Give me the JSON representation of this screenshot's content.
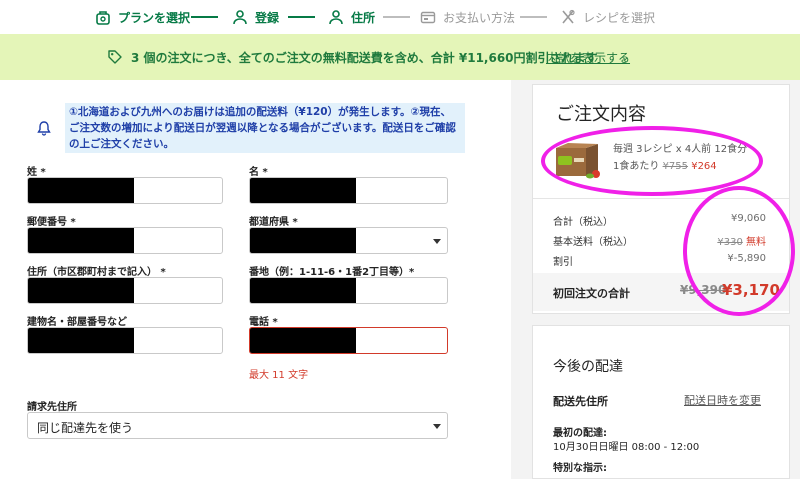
{
  "steps": [
    {
      "label": "プランを選択",
      "icon": "bag-icon"
    },
    {
      "label": "登録",
      "icon": "user-icon"
    },
    {
      "label": "住所",
      "icon": "user-icon"
    },
    {
      "label": "お支払い方法",
      "icon": "card-icon"
    },
    {
      "label": "レシピを選択",
      "icon": "utensils-icon"
    }
  ],
  "colors": {
    "accent": "#067a46",
    "banner_bg": "#e4f5b8",
    "error": "#d23a2a",
    "annotation": "#f020e8",
    "notice_bg": "#e2f1fb"
  },
  "promo": {
    "text": "3 個の注文につき、全てのご注文の無料配送費を含め、合計 ¥11,660円割引されます",
    "link": "内訳を表示する",
    "chevron": "⌄"
  },
  "notice": {
    "text": "①北海道および九州へのお届けは追加の配送料（¥120）が発生します。②現在、ご注文数の増加により配送日が翌週以降となる場合がございます。配送日をご確認の上ご注文ください。"
  },
  "form": {
    "last_name_label": "姓 *",
    "first_name_label": "名 *",
    "postal_label": "郵便番号 *",
    "prefecture_label": "都道府県 *",
    "city_label": "住所（市区郡町村まで記入） *",
    "street_label": "番地（例：1-11-6・1番2丁目等）*",
    "building_label": "建物名・部屋番号など",
    "phone_label": "電話 *",
    "phone_error": "最大 11 文字",
    "billing_label": "請求先住所",
    "billing_value": "同じ配達先を使う"
  },
  "summary": {
    "title": "ご注文内容",
    "plan_line1": "毎週 3レシピ x 4人前 12食分",
    "per_meal_label": "1食あたり",
    "per_meal_old": "¥755",
    "per_meal_new": "¥264",
    "subtotal_label": "合計（税込）",
    "subtotal_value": "¥9,060",
    "shipping_label": "基本送料（税込）",
    "shipping_old": "¥330",
    "shipping_new": "無料",
    "discount_label": "割引",
    "discount_value": "¥-5,890",
    "first_total_label": "初回注文の合計",
    "first_total_old": "¥9,390",
    "first_total_new": "¥3,170"
  },
  "delivery": {
    "title": "今後の配達",
    "address_label": "配送先住所",
    "change_link": "配送日時を変更",
    "first_label": "最初の配達:",
    "first_value": "10月30日日曜日 08:00 - 12:00",
    "instructions_label": "特別な指示:"
  }
}
